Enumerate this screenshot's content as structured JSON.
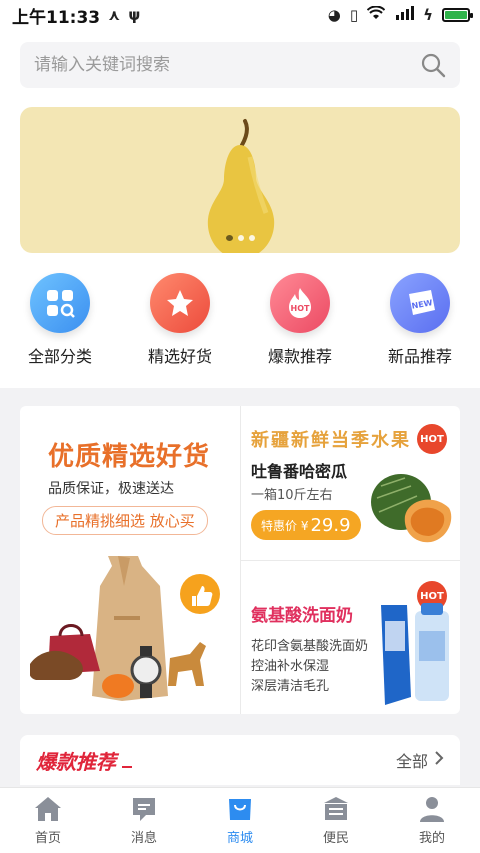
{
  "status": {
    "time": "上午11:33"
  },
  "search": {
    "placeholder": "请输入关键词搜索"
  },
  "categories": [
    {
      "label": "全部分类",
      "color": "#4aa3f0",
      "icon": "grid-search-icon"
    },
    {
      "label": "精选好货",
      "color": "#f0624d",
      "icon": "star-icon"
    },
    {
      "label": "爆款推荐",
      "color": "#f05b6d",
      "icon": "hot-fire-icon"
    },
    {
      "label": "新品推荐",
      "color": "#5c7cf0",
      "icon": "new-badge-icon"
    }
  ],
  "promo": {
    "left": {
      "title": "优质精选好货",
      "subtitle": "品质保证，极速送达",
      "pill": "产品精挑细选 放心买"
    },
    "right_top": {
      "tag": "新疆新鲜当季水果",
      "name": "吐鲁番哈密瓜",
      "spec": "一箱10斤左右",
      "price_label": "特惠价 ¥",
      "price_value": "29.9",
      "badge": "HOT"
    },
    "right_bottom": {
      "name": "氨基酸洗面奶",
      "lines": [
        "花印含氨基酸洗面奶",
        "控油补水保湿",
        "深层清洁毛孔"
      ],
      "badge": "HOT"
    }
  },
  "hot_section": {
    "title": "爆款推荐",
    "more": "全部"
  },
  "tabbar": [
    {
      "label": "首页",
      "icon": "home-icon"
    },
    {
      "label": "消息",
      "icon": "message-icon"
    },
    {
      "label": "商城",
      "icon": "shop-bag-icon"
    },
    {
      "label": "便民",
      "icon": "service-icon"
    },
    {
      "label": "我的",
      "icon": "profile-icon"
    }
  ],
  "colors": {
    "accent": "#2d8cf0",
    "hot_red": "#e0253a",
    "price_orange": "#f5a623"
  }
}
